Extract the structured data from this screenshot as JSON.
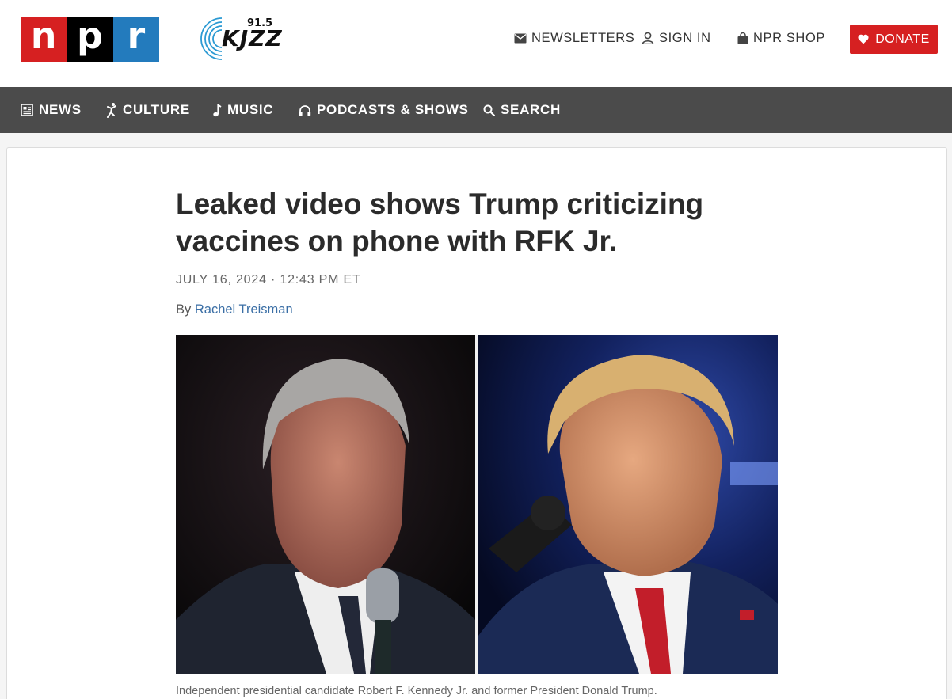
{
  "header": {
    "npr_logo": {
      "letters": [
        "n",
        "p",
        "r"
      ],
      "colors": [
        "#d62021",
        "#000000",
        "#237bbd"
      ]
    },
    "station_logo": {
      "freq": "91.5",
      "name": "KJZZ"
    },
    "utility_links": [
      {
        "label": "NEWSLETTERS",
        "icon": "envelope-icon"
      },
      {
        "label": "SIGN IN",
        "icon": "user-icon"
      },
      {
        "label": "NPR SHOP",
        "icon": "shopping-bag-icon"
      }
    ],
    "donate": {
      "label": "DONATE",
      "icon": "heart-icon",
      "color": "#d62021"
    }
  },
  "nav": {
    "items": [
      {
        "label": "NEWS",
        "icon": "news-icon"
      },
      {
        "label": "CULTURE",
        "icon": "culture-icon"
      },
      {
        "label": "MUSIC",
        "icon": "music-note-icon"
      },
      {
        "label": "PODCASTS & SHOWS",
        "icon": "headphones-icon"
      },
      {
        "label": "SEARCH",
        "icon": "search-icon"
      }
    ],
    "background": "#4b4b4b"
  },
  "article": {
    "headline_line1": "Leaked video shows Trump criticizing",
    "headline_line2": "vaccines on phone with RFK Jr.",
    "date": "JULY 16, 2024 · 12:43 PM ET",
    "byline_prefix": "By",
    "author": "Rachel Treisman",
    "caption": "Independent presidential candidate Robert F. Kennedy Jr. and former President Donald Trump."
  }
}
